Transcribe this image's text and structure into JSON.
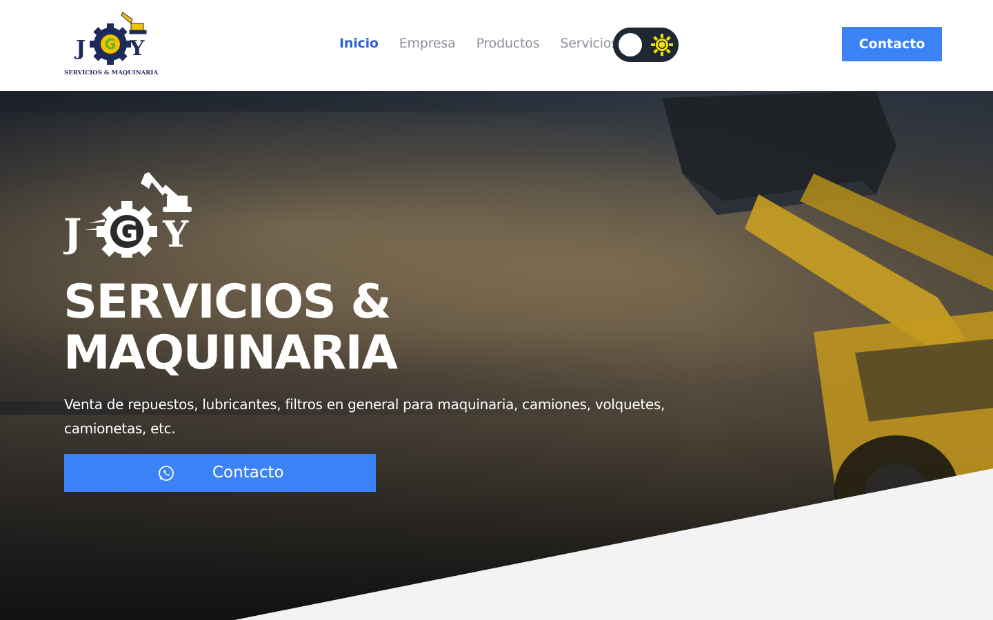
{
  "header": {
    "logo_text": "JGY",
    "logo_subtitle": "SERVICIOS & MAQUINARIA",
    "nav": [
      {
        "label": "Inicio",
        "active": true
      },
      {
        "label": "Empresa",
        "active": false
      },
      {
        "label": "Productos",
        "active": false
      },
      {
        "label": "Servicios",
        "active": false
      }
    ],
    "cta_label": "Contacto"
  },
  "hero": {
    "logo_text": "JGY",
    "title_line1": "SERVICIOS &",
    "title_line2": "MAQUINARIA",
    "description": "Venta de repuestos, lubricantes, filtros en general para maquinaria, camiones, volquetes, camionetas, etc.",
    "cta_label": "Contacto",
    "cta_icon": "whatsapp-icon"
  },
  "colors": {
    "accent": "#3a82f5",
    "nav_active": "#2d63cc",
    "nav_inactive": "#8e9099",
    "toggle_bg": "#1f2733",
    "sun": "#f2e600",
    "logo_navy": "#1e2a5a",
    "logo_yellow": "#f2c200",
    "bottom_section": "#f3f3f5"
  }
}
